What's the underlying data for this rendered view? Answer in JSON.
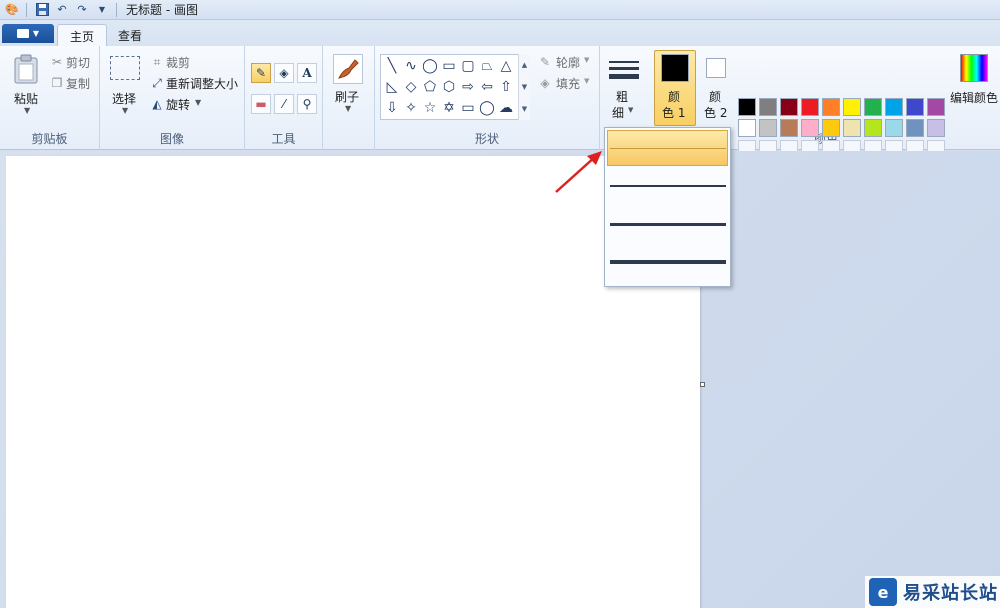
{
  "titlebar": {
    "title": "无标题 - 画图"
  },
  "tabs": {
    "home": "主页",
    "view": "查看"
  },
  "clipboard": {
    "paste": "粘贴",
    "cut": "剪切",
    "copy": "复制",
    "group_label": "剪贴板"
  },
  "image": {
    "select": "选择",
    "crop": "裁剪",
    "resize": "重新调整大小",
    "rotate": "旋转",
    "group_label": "图像"
  },
  "tools": {
    "group_label": "工具"
  },
  "brush": {
    "label": "刷子"
  },
  "shapes": {
    "outline": "轮廓",
    "fill": "填充",
    "group_label": "形状"
  },
  "size": {
    "line1": "粗",
    "line2": "细"
  },
  "colors": {
    "color1_line1": "颜",
    "color1_line2": "色 1",
    "color2_line1": "颜",
    "color2_line2": "色 2",
    "edit": "编辑颜色",
    "group_label": "颜色",
    "color1": "#000000",
    "color2": "#ffffff",
    "palette_row1": [
      "#000000",
      "#7f7f7f",
      "#880015",
      "#ed1c24",
      "#ff7f27",
      "#fff200",
      "#22b14c",
      "#00a2e8",
      "#3f48cc",
      "#a349a4"
    ],
    "palette_row2": [
      "#ffffff",
      "#c3c3c3",
      "#b97a57",
      "#ffaec9",
      "#ffc90e",
      "#efe4b0",
      "#b5e61d",
      "#99d9ea",
      "#7092be",
      "#c8bfe7"
    ]
  },
  "size_dropdown": {
    "options": [
      "1px",
      "3px",
      "5px",
      "8px"
    ],
    "selected_index": 0
  },
  "watermark": {
    "logo": "e",
    "text": "易采站长站"
  }
}
